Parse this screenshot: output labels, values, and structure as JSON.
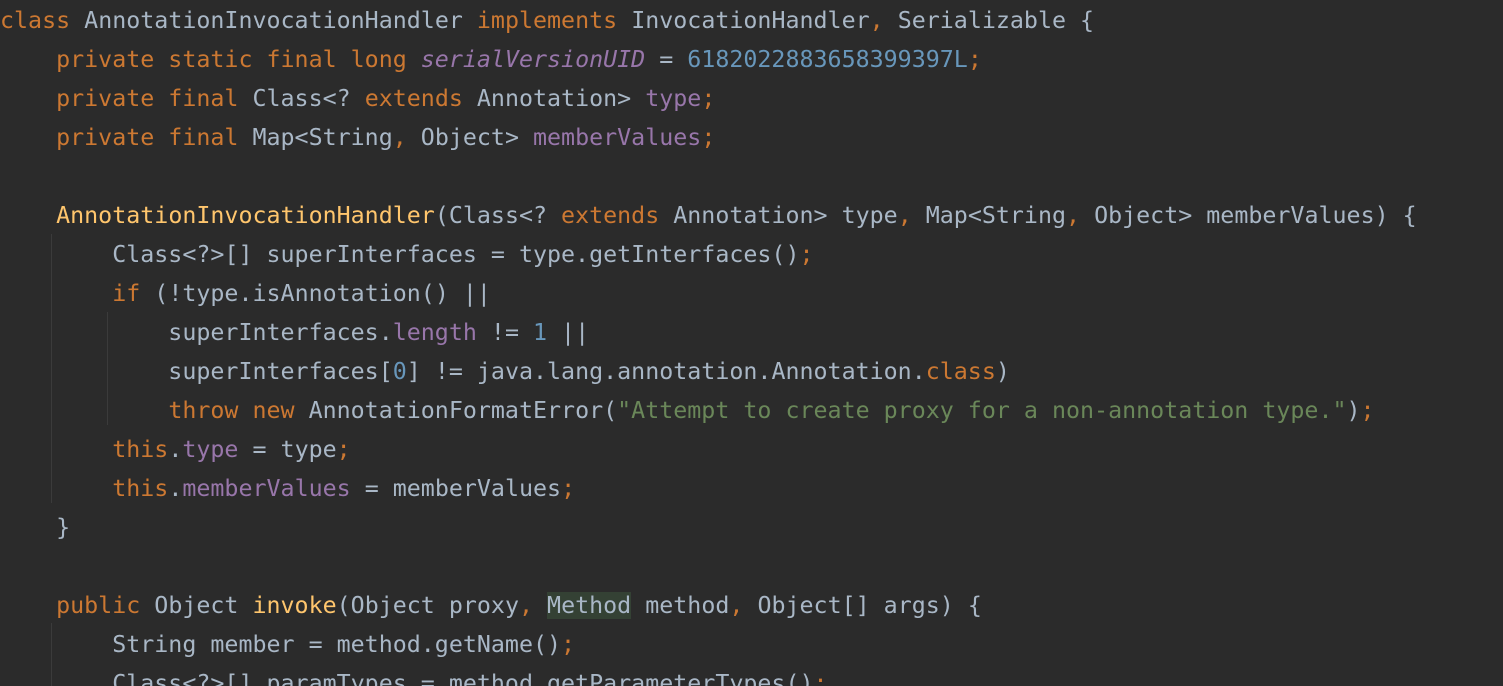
{
  "colors": {
    "background": "#2b2b2b",
    "plain": "#a9b7c6",
    "keyword": "#cc7832",
    "field": "#9876aa",
    "number": "#6897bb",
    "string": "#6a8759",
    "method_declaration": "#ffc66d",
    "usage_highlight": "#344134"
  },
  "lines": [
    {
      "tokens": [
        {
          "t": "class",
          "k": "keyword"
        },
        {
          "t": " AnnotationInvocationHandler ",
          "k": "plain"
        },
        {
          "t": "implements",
          "k": "keyword"
        },
        {
          "t": " InvocationHandler",
          "k": "plain"
        },
        {
          "t": ",",
          "k": "punct"
        },
        {
          "t": " Serializable {",
          "k": "plain"
        }
      ]
    },
    {
      "tokens": [
        {
          "t": "    private static final long ",
          "k": "keyword"
        },
        {
          "t": "serialVersionUID",
          "k": "static-field"
        },
        {
          "t": " = ",
          "k": "plain"
        },
        {
          "t": "6182022883658399397L",
          "k": "number"
        },
        {
          "t": ";",
          "k": "punct"
        }
      ]
    },
    {
      "tokens": [
        {
          "t": "    private final ",
          "k": "keyword"
        },
        {
          "t": "Class<? ",
          "k": "plain"
        },
        {
          "t": "extends",
          "k": "keyword"
        },
        {
          "t": " Annotation> ",
          "k": "plain"
        },
        {
          "t": "type",
          "k": "field"
        },
        {
          "t": ";",
          "k": "punct"
        }
      ]
    },
    {
      "tokens": [
        {
          "t": "    private final ",
          "k": "keyword"
        },
        {
          "t": "Map<String",
          "k": "plain"
        },
        {
          "t": ",",
          "k": "punct"
        },
        {
          "t": " Object> ",
          "k": "plain"
        },
        {
          "t": "memberValues",
          "k": "field"
        },
        {
          "t": ";",
          "k": "punct"
        }
      ]
    },
    {
      "tokens": []
    },
    {
      "tokens": [
        {
          "t": "    ",
          "k": "plain"
        },
        {
          "t": "AnnotationInvocationHandler",
          "k": "method-decl"
        },
        {
          "t": "(Class<? ",
          "k": "plain"
        },
        {
          "t": "extends",
          "k": "keyword"
        },
        {
          "t": " Annotation> type",
          "k": "plain"
        },
        {
          "t": ",",
          "k": "punct"
        },
        {
          "t": " Map<String",
          "k": "plain"
        },
        {
          "t": ",",
          "k": "punct"
        },
        {
          "t": " Object> memberValues) {",
          "k": "plain"
        }
      ]
    },
    {
      "tokens": [
        {
          "t": "        Class<?>[] superInterfaces = type.getInterfaces()",
          "k": "plain"
        },
        {
          "t": ";",
          "k": "punct"
        }
      ]
    },
    {
      "tokens": [
        {
          "t": "        ",
          "k": "plain"
        },
        {
          "t": "if",
          "k": "keyword"
        },
        {
          "t": " (!type.isAnnotation() ||",
          "k": "plain"
        }
      ]
    },
    {
      "tokens": [
        {
          "t": "            superInterfaces.",
          "k": "plain"
        },
        {
          "t": "length",
          "k": "field"
        },
        {
          "t": " != ",
          "k": "plain"
        },
        {
          "t": "1",
          "k": "number"
        },
        {
          "t": " ||",
          "k": "plain"
        }
      ]
    },
    {
      "tokens": [
        {
          "t": "            superInterfaces[",
          "k": "plain"
        },
        {
          "t": "0",
          "k": "number"
        },
        {
          "t": "] != java.lang.annotation.Annotation.",
          "k": "plain"
        },
        {
          "t": "class",
          "k": "keyword"
        },
        {
          "t": ")",
          "k": "plain"
        }
      ]
    },
    {
      "tokens": [
        {
          "t": "            ",
          "k": "plain"
        },
        {
          "t": "throw new",
          "k": "keyword"
        },
        {
          "t": " AnnotationFormatError(",
          "k": "plain"
        },
        {
          "t": "\"Attempt to create proxy for a non-annotation type.\"",
          "k": "string"
        },
        {
          "t": ")",
          "k": "plain"
        },
        {
          "t": ";",
          "k": "punct"
        }
      ]
    },
    {
      "tokens": [
        {
          "t": "        ",
          "k": "plain"
        },
        {
          "t": "this",
          "k": "keyword"
        },
        {
          "t": ".",
          "k": "plain"
        },
        {
          "t": "type",
          "k": "field"
        },
        {
          "t": " = type",
          "k": "plain"
        },
        {
          "t": ";",
          "k": "punct"
        }
      ]
    },
    {
      "tokens": [
        {
          "t": "        ",
          "k": "plain"
        },
        {
          "t": "this",
          "k": "keyword"
        },
        {
          "t": ".",
          "k": "plain"
        },
        {
          "t": "memberValues",
          "k": "field"
        },
        {
          "t": " = memberValues",
          "k": "plain"
        },
        {
          "t": ";",
          "k": "punct"
        }
      ]
    },
    {
      "tokens": [
        {
          "t": "    }",
          "k": "plain"
        }
      ]
    },
    {
      "tokens": []
    },
    {
      "tokens": [
        {
          "t": "    ",
          "k": "plain"
        },
        {
          "t": "public",
          "k": "keyword"
        },
        {
          "t": " Object ",
          "k": "plain"
        },
        {
          "t": "invoke",
          "k": "method-decl"
        },
        {
          "t": "(Object proxy",
          "k": "plain"
        },
        {
          "t": ",",
          "k": "punct"
        },
        {
          "t": " ",
          "k": "plain"
        },
        {
          "t": "Method",
          "k": "plain",
          "hl": true
        },
        {
          "t": " method",
          "k": "plain"
        },
        {
          "t": ",",
          "k": "punct"
        },
        {
          "t": " Object[] args) {",
          "k": "plain"
        }
      ]
    },
    {
      "tokens": [
        {
          "t": "        String member = method.getName()",
          "k": "plain"
        },
        {
          "t": ";",
          "k": "punct"
        }
      ]
    },
    {
      "tokens": [
        {
          "t": "        Class<?>[] paramTypes = method.getParameterTypes()",
          "k": "plain"
        },
        {
          "t": ";",
          "k": "punct"
        }
      ]
    }
  ]
}
